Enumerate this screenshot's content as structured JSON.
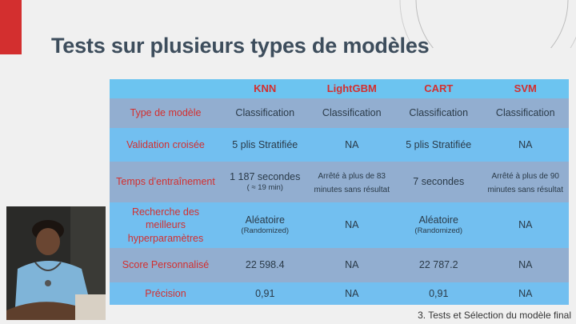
{
  "slide": {
    "title": "Tests sur plusieurs types de modèles",
    "footer": "3. Tests et Sélection du modèle final"
  },
  "table": {
    "headers": [
      "",
      "KNN",
      "LightGBM",
      "CART",
      "SVM"
    ],
    "rows": [
      {
        "label": "Type de modèle",
        "cells": [
          {
            "main": "Classification"
          },
          {
            "main": "Classification"
          },
          {
            "main": "Classification"
          },
          {
            "main": "Classification"
          }
        ]
      },
      {
        "label": "Validation croisée",
        "cells": [
          {
            "main": "5 plis Stratifiée"
          },
          {
            "main": "NA"
          },
          {
            "main": "5 plis Stratifiée"
          },
          {
            "main": "NA"
          }
        ]
      },
      {
        "label": "Temps d’entraînement",
        "cells": [
          {
            "main": "1 187 secondes",
            "sub": "( ≈ 19 min)"
          },
          {
            "note": "Arrêté à plus de 83 minutes sans résultat"
          },
          {
            "main": "7 secondes"
          },
          {
            "note": "Arrêté à plus de 90 minutes sans résultat"
          }
        ]
      },
      {
        "label": "Recherche des meilleurs hyperparamètres",
        "cells": [
          {
            "main": "Aléatoire",
            "sub": "(Randomized)"
          },
          {
            "main": "NA"
          },
          {
            "main": "Aléatoire",
            "sub": "(Randomized)"
          },
          {
            "main": "NA"
          }
        ]
      },
      {
        "label": "Score Personnalisé",
        "cells": [
          {
            "main": "22 598.4"
          },
          {
            "main": "NA"
          },
          {
            "main": "22 787.2"
          },
          {
            "main": "NA"
          }
        ]
      },
      {
        "label": "Précision",
        "cells": [
          {
            "main": "0,91"
          },
          {
            "main": "NA"
          },
          {
            "main": "0,91"
          },
          {
            "main": "NA"
          }
        ]
      }
    ]
  },
  "colors": {
    "accent_red": "#d32f2f",
    "title_color": "#3d4d5c",
    "header_bg": "#6cc4f0",
    "row_dark": "#92aed0",
    "row_light": "#72bff0"
  }
}
